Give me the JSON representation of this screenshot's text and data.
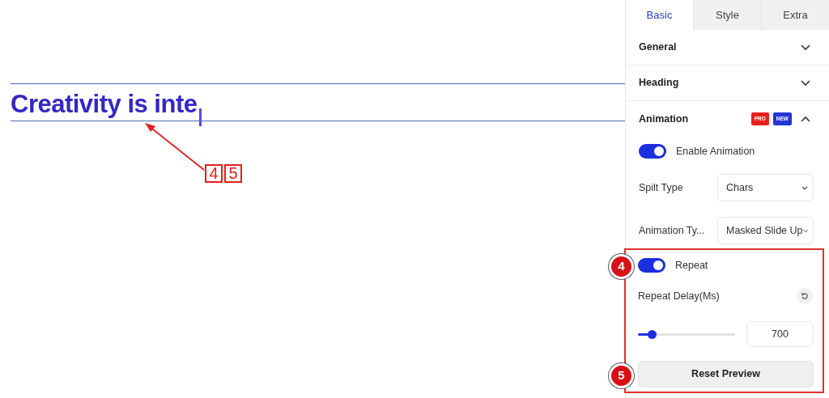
{
  "canvas": {
    "heading": "Creativity is inte",
    "callout_labels": [
      "4",
      "5"
    ]
  },
  "tabs": [
    {
      "label": "Basic",
      "selected": true
    },
    {
      "label": "Style",
      "selected": false
    },
    {
      "label": "Extra",
      "selected": false
    }
  ],
  "sections": [
    {
      "title": "General",
      "expanded": false
    },
    {
      "title": "Heading",
      "expanded": false
    },
    {
      "title": "Animation",
      "expanded": true,
      "badges": [
        {
          "label": "PRO",
          "color": "#e8201f"
        },
        {
          "label": "NEW",
          "color": "#2334d8"
        }
      ]
    }
  ],
  "animation": {
    "enable": {
      "label": "Enable Animation",
      "on": true
    },
    "split_type": {
      "label": "Spilt Type",
      "value": "Chars"
    },
    "animation_type": {
      "label": "Animation Ty...",
      "value": "Masked Slide Up"
    },
    "repeat": {
      "label": "Repeat",
      "on": true
    },
    "repeat_delay": {
      "label": "Repeat Delay(Ms)",
      "level": 0.14,
      "value": "700"
    },
    "reset_button": "Reset Preview"
  },
  "markers": [
    "4",
    "5"
  ]
}
